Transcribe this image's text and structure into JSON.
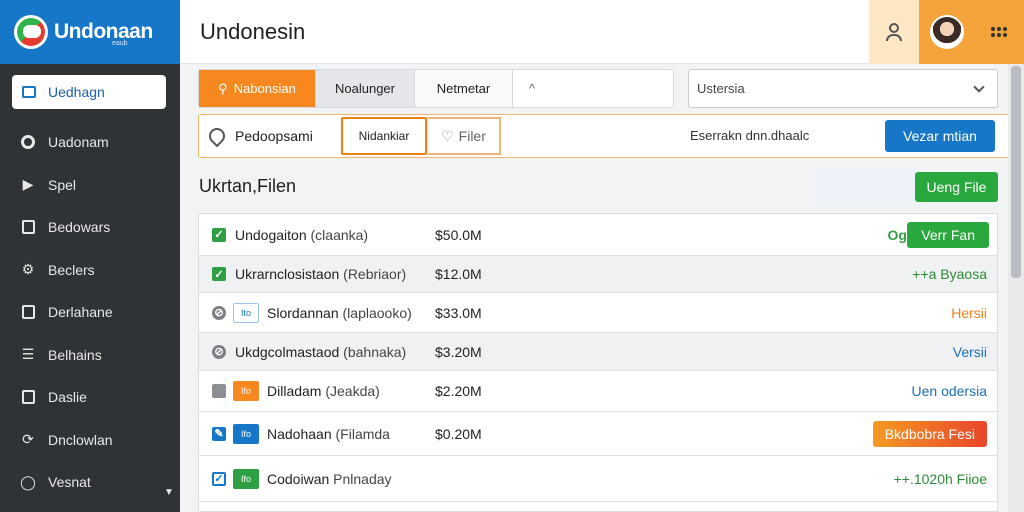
{
  "brand": {
    "name": "Undonaan",
    "sub": "eaub"
  },
  "sidebar": {
    "active": "Uedhagn",
    "items": [
      {
        "label": "Uadonam",
        "icon": "circle-icon"
      },
      {
        "label": "Spel",
        "icon": "tag-icon"
      },
      {
        "label": "Bedowars",
        "icon": "calendar-icon"
      },
      {
        "label": "Beclers",
        "icon": "gear-icon"
      },
      {
        "label": "Derlahane",
        "icon": "document-icon"
      },
      {
        "label": "Belhains",
        "icon": "stack-icon"
      },
      {
        "label": "Daslie",
        "icon": "clipboard-icon"
      },
      {
        "label": "Dnclowlan",
        "icon": "refresh-icon"
      },
      {
        "label": "Vesnat",
        "icon": "user-icon"
      }
    ]
  },
  "header": {
    "title": "Undonesin"
  },
  "tabs": [
    "Nabonsian",
    "Noalunger",
    "Netmetar",
    "^"
  ],
  "select": {
    "value": "Ustersia"
  },
  "row2": {
    "chip_a": "Pedoopsami",
    "chip_b": "Nidankiar",
    "chip_c": "Filer",
    "text": "Eserrakn dnn.dhaalc",
    "button": "Vezar mtian"
  },
  "section": {
    "title": "Ukrtan,Filen",
    "upload": "Ueng File"
  },
  "rows": [
    {
      "name": "Undogaiton",
      "type": "(claanka)",
      "size": "$50.0M",
      "status": "Verr Fan",
      "status_prefix": "Og",
      "tag": ""
    },
    {
      "name": "Ukrarnclosistaon",
      "type": "(Rebriaor)",
      "size": "$12.0M",
      "status": "++a Byaosa",
      "tag": ""
    },
    {
      "name": "Slordannan",
      "type": "(laplaooko)",
      "size": "$33.0M",
      "status": "Hersii",
      "tag": "Ito"
    },
    {
      "name": "Ukdgcolmastaod",
      "type": "(bahnaka)",
      "size": "$3.20M",
      "status": "Versii",
      "tag": ""
    },
    {
      "name": "Dilladam",
      "type": "(Jeakda)",
      "size": "$2.20M",
      "status": "Uen odersia",
      "tag": "Ifo"
    },
    {
      "name": "Nadohaan",
      "type": "(Filamda",
      "size": "$0.20M",
      "status": "Bkdbobra Fesi",
      "tag": "Ifo"
    },
    {
      "name": "Codoiwan",
      "type": "Pnlnaday",
      "size": "",
      "status": "++.1020h Fiioe",
      "tag": "Ifo"
    }
  ],
  "colors": {
    "accent_blue": "#1677c8",
    "accent_orange": "#f7881f",
    "accent_green": "#29a83d"
  }
}
